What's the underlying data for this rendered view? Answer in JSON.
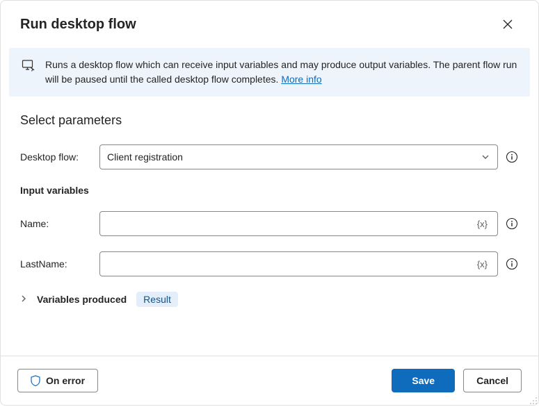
{
  "header": {
    "title": "Run desktop flow"
  },
  "banner": {
    "text": "Runs a desktop flow which can receive input variables and may produce output variables. The parent flow run will be paused until the called desktop flow completes. ",
    "link_text": "More info"
  },
  "section_title": "Select parameters",
  "fields": {
    "desktop_flow": {
      "label": "Desktop flow:",
      "value": "Client registration"
    },
    "input_variables_heading": "Input variables",
    "name": {
      "label": "Name:",
      "value": "",
      "token": "{x}"
    },
    "lastname": {
      "label": "LastName:",
      "value": "",
      "token": "{x}"
    }
  },
  "variables_produced": {
    "label": "Variables produced",
    "badge": "Result"
  },
  "footer": {
    "on_error": "On error",
    "save": "Save",
    "cancel": "Cancel"
  }
}
